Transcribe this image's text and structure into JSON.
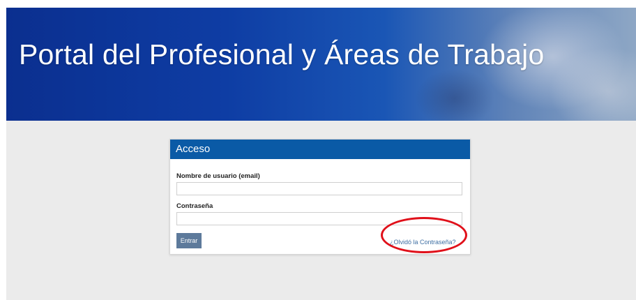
{
  "banner": {
    "title": "Portal del Profesional y Áreas de Trabajo"
  },
  "login": {
    "header": "Acceso",
    "username_label": "Nombre de usuario (email)",
    "username_value": "",
    "password_label": "Contraseña",
    "password_value": "",
    "submit_label": "Entrar",
    "forgot_link": "¿Olvidó la Contraseña?"
  },
  "colors": {
    "banner_blue": "#0b2f8f",
    "header_blue": "#0a5aa6",
    "button": "#5d7a9b",
    "link": "#3f6fa3",
    "highlight": "#e0101a"
  }
}
